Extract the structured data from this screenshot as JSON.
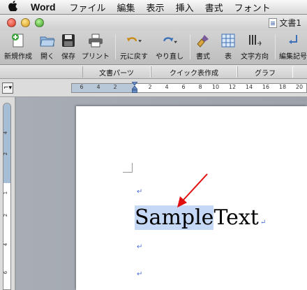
{
  "menubar": {
    "app": "Word",
    "items": [
      "ファイル",
      "編集",
      "表示",
      "挿入",
      "書式",
      "フォント"
    ]
  },
  "window": {
    "title": "文書1"
  },
  "toolbar": {
    "new_label": "新規作成",
    "open_label": "開く",
    "save_label": "保存",
    "print_label": "プリント",
    "undo_label": "元に戻す",
    "redo_label": "やり直し",
    "format_label": "書式",
    "table_label": "表",
    "text_direction_label": "文字方向",
    "edit_label": "編集記号"
  },
  "ribbon": {
    "tabs": [
      "文書パーツ",
      "クイック表作成",
      "グラフ"
    ]
  },
  "ruler": {
    "h_numbers": [
      "6",
      "4",
      "2",
      "2",
      "4",
      "6",
      "8",
      "10",
      "12",
      "14",
      "16",
      "18",
      "20"
    ],
    "v_numbers": [
      "4",
      "2",
      "1",
      "2",
      "4",
      "6"
    ]
  },
  "document": {
    "selected_text": "Sample",
    "rest_text": " Text",
    "para_mark": "↵"
  },
  "colors": {
    "selection": "#c5d8f5",
    "arrow": "#e01010",
    "para_mark": "#4a6fd6"
  }
}
